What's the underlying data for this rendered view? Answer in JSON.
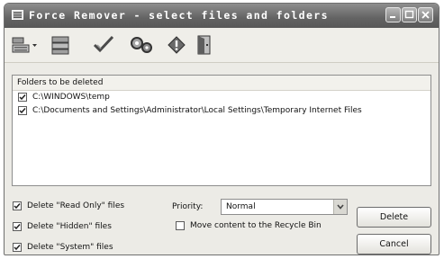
{
  "window": {
    "title": "Force Remover - select files and folders"
  },
  "list": {
    "header": "Folders to be deleted",
    "rows": [
      {
        "path": "C:\\WINDOWS\\temp",
        "checked": true
      },
      {
        "path": "C:\\Documents and Settings\\Administrator\\Local Settings\\Temporary Internet Files",
        "checked": true
      }
    ]
  },
  "options": {
    "read_only": {
      "label": "Delete \"Read Only\" files",
      "checked": true
    },
    "hidden": {
      "label": "Delete \"Hidden\" files",
      "checked": true
    },
    "system": {
      "label": "Delete \"System\" files",
      "checked": true
    },
    "recycle": {
      "label": "Move content to the Recycle Bin",
      "checked": false
    }
  },
  "priority": {
    "label": "Priority:",
    "value": "Normal"
  },
  "buttons": {
    "delete": "Delete",
    "cancel": "Cancel"
  },
  "colors": {
    "titlebar": "#636363",
    "window_bg": "#ecebe6",
    "toolbar_bg": "#efeee9"
  }
}
